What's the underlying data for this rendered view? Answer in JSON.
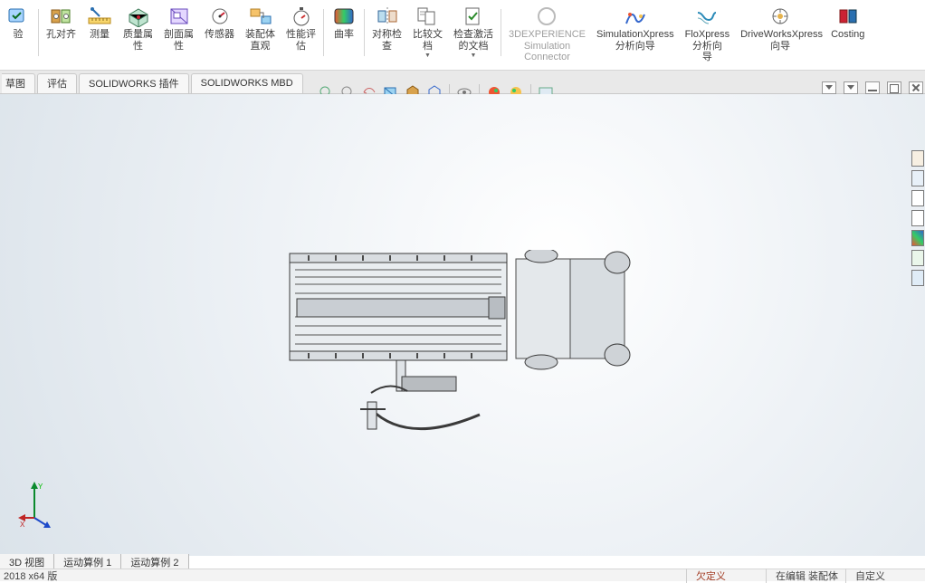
{
  "ribbon": {
    "items": [
      {
        "id": "verify",
        "label": "验"
      },
      {
        "id": "hole-align",
        "label": "孔对齐"
      },
      {
        "id": "measure",
        "label": "测量"
      },
      {
        "id": "mass-props",
        "label": "质量属\n性"
      },
      {
        "id": "section-props",
        "label": "剖面属\n性"
      },
      {
        "id": "sensors",
        "label": "传感器"
      },
      {
        "id": "asm-visual",
        "label": "装配体\n直观"
      },
      {
        "id": "perf-eval",
        "label": "性能评\n估"
      },
      {
        "id": "curvature",
        "label": "曲率"
      },
      {
        "id": "symmetry-check",
        "label": "对称检\n查"
      },
      {
        "id": "compare-docs",
        "label": "比较文\n档",
        "dropdown": true
      },
      {
        "id": "check-active",
        "label": "检查激活\n的文档",
        "dropdown": true
      },
      {
        "id": "3dexp",
        "label": "3DEXPERIENCE\nSimulation\nConnector",
        "disabled": true
      },
      {
        "id": "simxpress",
        "label": "SimulationXpress\n分析向导"
      },
      {
        "id": "floxpress",
        "label": "FloXpress\n分析向\n导"
      },
      {
        "id": "dwxpress",
        "label": "DriveWorksXpress\n向导"
      },
      {
        "id": "costing",
        "label": "Costing"
      }
    ],
    "separators_after": [
      "verify",
      "perf-eval",
      "curvature",
      "check-active"
    ]
  },
  "tabs": [
    {
      "id": "drawing",
      "label": "草图",
      "partial": true
    },
    {
      "id": "evaluate",
      "label": "评估"
    },
    {
      "id": "sw-addins",
      "label": "SOLIDWORKS 插件"
    },
    {
      "id": "sw-mbd",
      "label": "SOLIDWORKS MBD"
    }
  ],
  "hud_buttons": [
    "zoom-fit-icon",
    "zoom-area-icon",
    "prev-view-icon",
    "section-view-icon",
    "dynamic-view-icon",
    "display-style-icon",
    "sep",
    "hide-show-icon",
    "sep",
    "edit-appearance-icon",
    "apply-scene-icon",
    "sep",
    "view-settings-icon"
  ],
  "triad": {
    "x": "X",
    "y": "Y",
    "z": ""
  },
  "bottom_tabs": [
    {
      "id": "3dview",
      "label": "3D 视图"
    },
    {
      "id": "motion1",
      "label": "运动算例 1"
    },
    {
      "id": "motion2",
      "label": "运动算例 2"
    }
  ],
  "status": {
    "version": " 2018 x64 版",
    "segments": [
      {
        "id": "underdef",
        "text": "欠定义",
        "emph": true
      },
      {
        "id": "editing",
        "text": "在编辑 装配体"
      },
      {
        "id": "custom",
        "text": "自定义"
      }
    ]
  }
}
